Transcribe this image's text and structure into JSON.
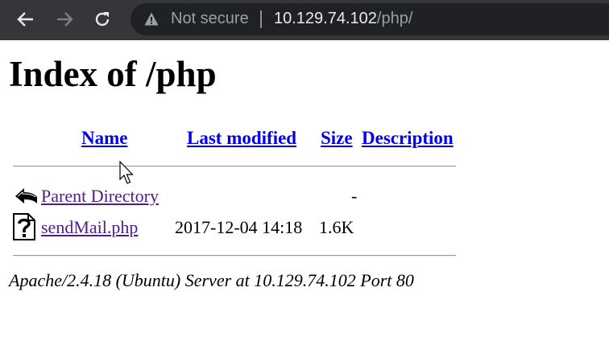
{
  "browser": {
    "security_label": "Not secure",
    "url_host": "10.129.74.102",
    "url_path": "/php/"
  },
  "page": {
    "title": "Index of /php",
    "columns": [
      "Name",
      "Last modified",
      "Size",
      "Description"
    ],
    "rows": [
      {
        "icon": "back-folder-icon",
        "name": "Parent Directory",
        "modified": "",
        "size": "-",
        "description": ""
      },
      {
        "icon": "unknown-file-icon",
        "name": "sendMail.php",
        "modified": "2017-12-04 14:18",
        "size": "1.6K",
        "description": ""
      }
    ],
    "footer": "Apache/2.4.18 (Ubuntu) Server at 10.129.74.102 Port 80"
  }
}
